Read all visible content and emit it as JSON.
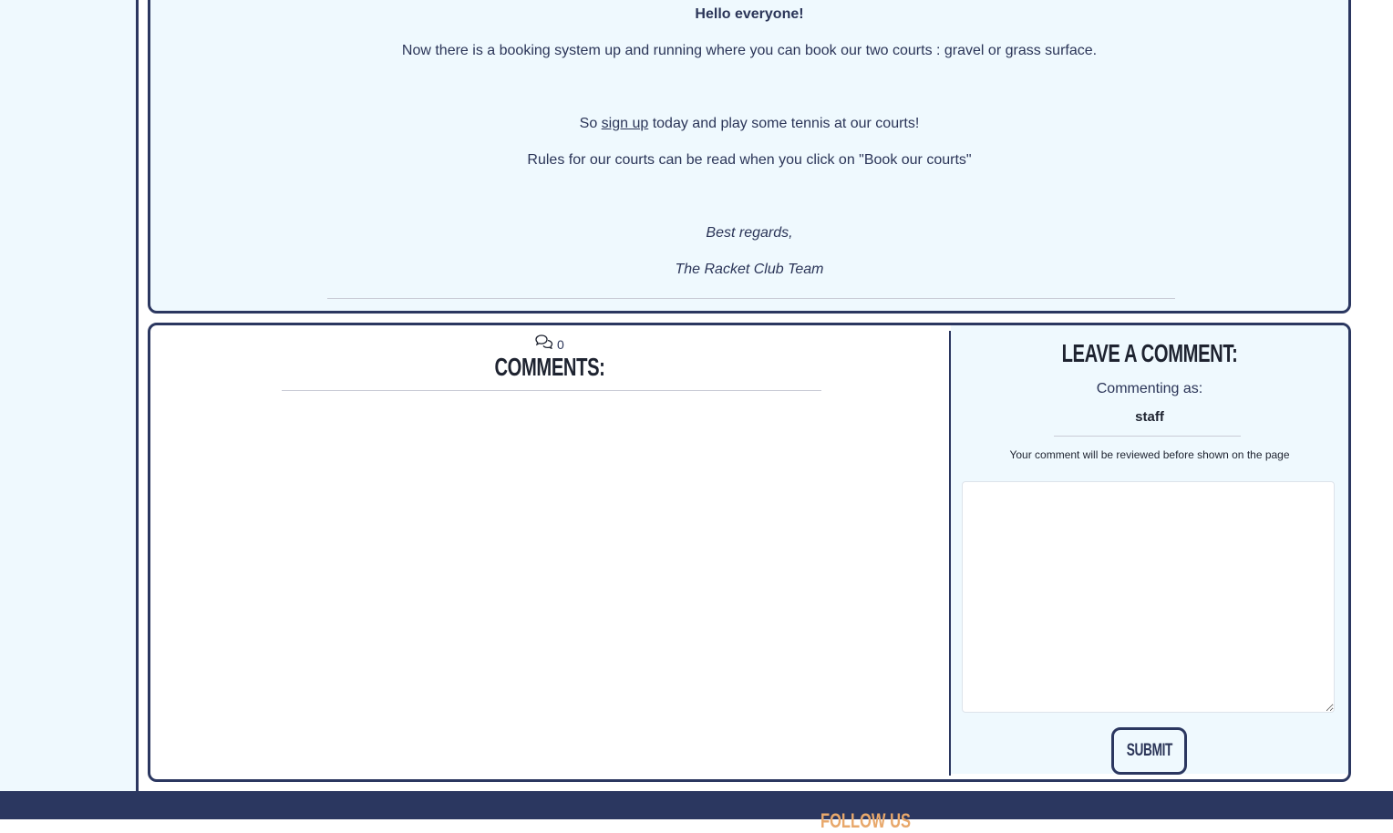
{
  "post": {
    "greeting": "Hello everyone!",
    "line1": "Now there is a booking system up and running where you can book our two courts : gravel or grass surface.",
    "signup_pre": "So ",
    "signup_link": "sign up",
    "signup_post": " today and play some tennis at our courts!",
    "rules": "Rules for our courts can be read when you click on \"Book our courts\"",
    "regards": "Best regards,",
    "team": "The Racket Club Team"
  },
  "comments": {
    "count": "0",
    "title": "Comments:"
  },
  "leave": {
    "title": "Leave a comment:",
    "commenting_as": "Commenting as:",
    "user": "staff",
    "notice": "Your comment will be reviewed before shown on the page",
    "submit": "Submit"
  },
  "footer": {
    "follow": "FOLLOW US"
  }
}
